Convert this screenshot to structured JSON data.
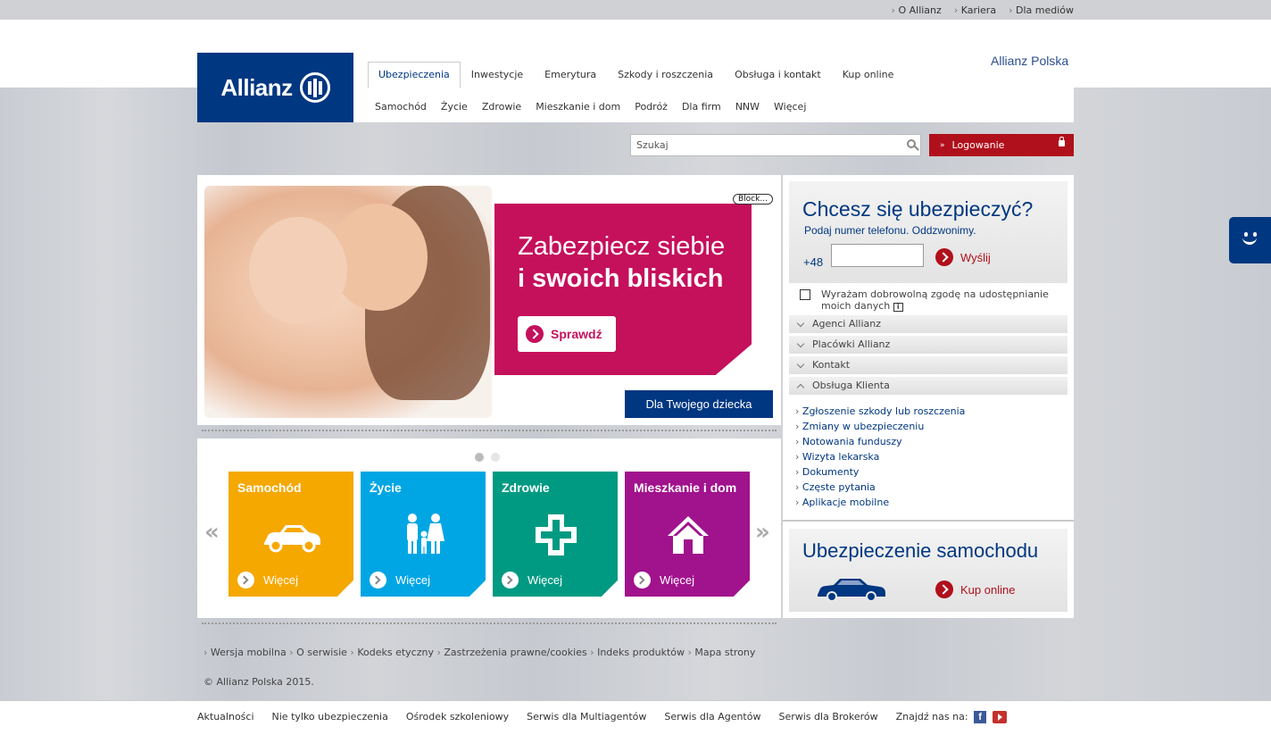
{
  "topbar": {
    "links": [
      "O Allianz",
      "Kariera",
      "Dla mediów"
    ]
  },
  "brand": {
    "logo_text": "Allianz",
    "site_name": "Allianz Polska"
  },
  "main_nav": [
    "Ubezpieczenia",
    "Inwestycje",
    "Emerytura",
    "Szkody i roszczenia",
    "Obsługa i kontakt",
    "Kup online"
  ],
  "sub_nav": [
    "Samochód",
    "Życie",
    "Zdrowie",
    "Mieszkanie i dom",
    "Podróż",
    "Dla firm",
    "NNW",
    "Więcej"
  ],
  "search": {
    "placeholder": "Szukaj"
  },
  "login": {
    "label": "Logowanie"
  },
  "hero": {
    "line1": "Zabezpiecz siebie",
    "line2": "i swoich bliskich",
    "button": "Sprawdź",
    "caption": "Dla Twojego dziecka",
    "block_tag": "Block..."
  },
  "carousel": {
    "prev": "«",
    "next": "»",
    "tiles": [
      {
        "title": "Samochód",
        "more": "Więcej",
        "color": "#f5a800",
        "icon": "car-icon"
      },
      {
        "title": "Życie",
        "more": "Więcej",
        "color": "#00a6e3",
        "icon": "family-icon"
      },
      {
        "title": "Zdrowie",
        "more": "Więcej",
        "color": "#009a82",
        "icon": "cross-icon"
      },
      {
        "title": "Mieszkanie i dom",
        "more": "Więcej",
        "color": "#a1128d",
        "icon": "house-icon"
      }
    ]
  },
  "callback": {
    "title": "Chcesz się ubezpieczyć?",
    "subtitle": "Podaj numer telefonu. Oddzwonimy.",
    "prefix": "+48",
    "send": "Wyślij",
    "consent": "Wyrażam dobrowolną zgodę na udostępnianie moich danych",
    "info_glyph": "i"
  },
  "accordion": [
    "Agenci Allianz",
    "Placówki Allianz",
    "Kontakt",
    "Obsługa Klienta"
  ],
  "service_links": [
    "Zgłoszenie szkody lub roszczenia",
    "Zmiany w ubezpieczeniu",
    "Notowania funduszy",
    "Wizyta lekarska",
    "Dokumenty",
    "Częste pytania",
    "Aplikacje mobilne"
  ],
  "car_promo": {
    "title": "Ubezpieczenie samochodu",
    "cta": "Kup online"
  },
  "footer": {
    "links": [
      "Wersja mobilna",
      "O serwisie",
      "Kodeks etyczny",
      "Zastrzeżenia prawne/cookies",
      "Indeks produktów",
      "Mapa strony"
    ],
    "copyright": "© Allianz Polska 2015.",
    "bottom_nav": [
      "Aktualności",
      "Nie tylko ubezpieczenia",
      "Ośrodek szkoleniowy",
      "Serwis dla Multiagentów",
      "Serwis dla Agentów",
      "Serwis dla Brokerów"
    ],
    "social_label": "Znajdź nas na:",
    "fb_glyph": "f"
  },
  "colors": {
    "brand_blue": "#003781",
    "login_red": "#b0101b",
    "promo_magenta": "#c5105c"
  }
}
